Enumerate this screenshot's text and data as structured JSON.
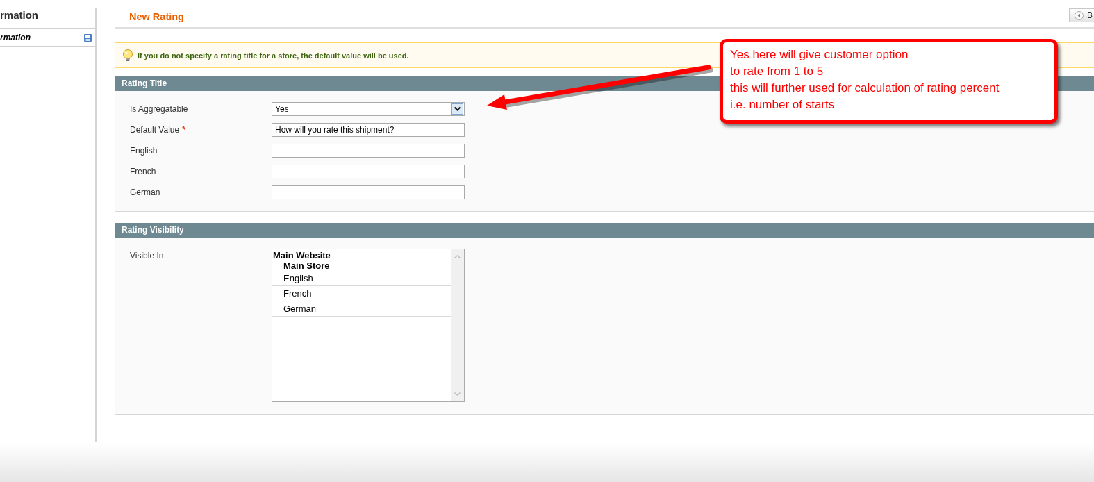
{
  "sidebar": {
    "title": "rmation",
    "tabs": [
      {
        "label": "rmation",
        "selected": true
      }
    ]
  },
  "page": {
    "title": "New Rating",
    "back_button": "B"
  },
  "notice": "If you do not specify a rating title for a store, the default value will be used.",
  "sections": [
    {
      "title": "Rating Title",
      "fields": [
        {
          "kind": "select",
          "label": "Is Aggregatable",
          "value": "Yes"
        },
        {
          "kind": "text",
          "label": "Default Value",
          "required_mark": "*",
          "value": "How will you rate this shipment?"
        },
        {
          "kind": "text",
          "label": "English"
        },
        {
          "kind": "text",
          "label": "French"
        },
        {
          "kind": "text",
          "label": "German"
        }
      ]
    },
    {
      "title": "Rating Visibility",
      "fields": [
        {
          "kind": "multiselect",
          "label": "Visible In",
          "options": [
            {
              "label": "Main Website",
              "children": [
                {
                  "label": "Main Store",
                  "children": [
                    {
                      "label": "English",
                      "selected": false
                    },
                    {
                      "label": "French",
                      "selected": false
                    },
                    {
                      "label": "German",
                      "selected": false
                    }
                  ]
                }
              ]
            }
          ]
        }
      ]
    }
  ],
  "annotation": {
    "lines": [
      "Yes here will give customer option",
      "to rate from 1 to 5",
      "this will further used for calculation of rating percent",
      "i.e. number of starts"
    ]
  }
}
